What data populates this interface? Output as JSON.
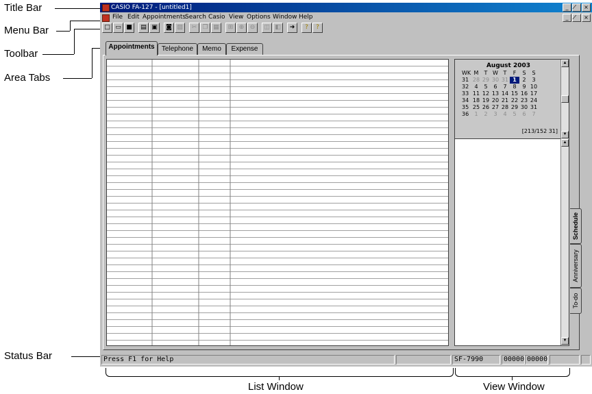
{
  "callouts": {
    "title_bar": "Title Bar",
    "menu_bar": "Menu Bar",
    "toolbar": "Toolbar",
    "area_tabs": "Area Tabs",
    "status_bar": "Status Bar",
    "list_window": "List Window",
    "view_window": "View Window"
  },
  "window": {
    "title": "CASIO FA-127 - [untitled1]",
    "buttons": [
      "_",
      "̸",
      "×"
    ]
  },
  "menu": [
    "File",
    "Edit",
    "Appointments",
    "Search",
    "Casio",
    "View",
    "Options",
    "Window",
    "Help"
  ],
  "toolbar_icons": [
    "new-icon",
    "open-icon",
    "save-icon",
    "print-icon",
    "print-preview-icon",
    "import-icon",
    "export-icon",
    "cut-icon",
    "copy-icon",
    "paste-icon",
    "find-icon",
    "zoom-in-icon",
    "zoom-out-icon",
    "cascade-icon",
    "tile-icon",
    "transfer-icon",
    "help-icon",
    "context-help-icon"
  ],
  "tabs": [
    "Appointments",
    "Telephone",
    "Memo",
    "Expense"
  ],
  "side_tabs": [
    "Schedule",
    "Anniversary",
    "To-do"
  ],
  "calendar": {
    "title": "August 2003",
    "headers": [
      "WK",
      "M",
      "T",
      "W",
      "T",
      "F",
      "S",
      "S"
    ],
    "weeks": [
      [
        "31",
        "28",
        "29",
        "30",
        "31",
        "1",
        "2",
        "3"
      ],
      [
        "32",
        "4",
        "5",
        "6",
        "7",
        "8",
        "9",
        "10"
      ],
      [
        "33",
        "11",
        "12",
        "13",
        "14",
        "15",
        "16",
        "17"
      ],
      [
        "34",
        "18",
        "19",
        "20",
        "21",
        "22",
        "23",
        "24"
      ],
      [
        "35",
        "25",
        "26",
        "27",
        "28",
        "29",
        "30",
        "31"
      ],
      [
        "36",
        "1",
        "2",
        "3",
        "4",
        "5",
        "6",
        "7"
      ]
    ],
    "selected": "1",
    "range": "[213/152 31]"
  },
  "status": {
    "help": "Press F1 for Help",
    "model": "SF-7990",
    "counter1": "00000",
    "counter2": "00000"
  }
}
